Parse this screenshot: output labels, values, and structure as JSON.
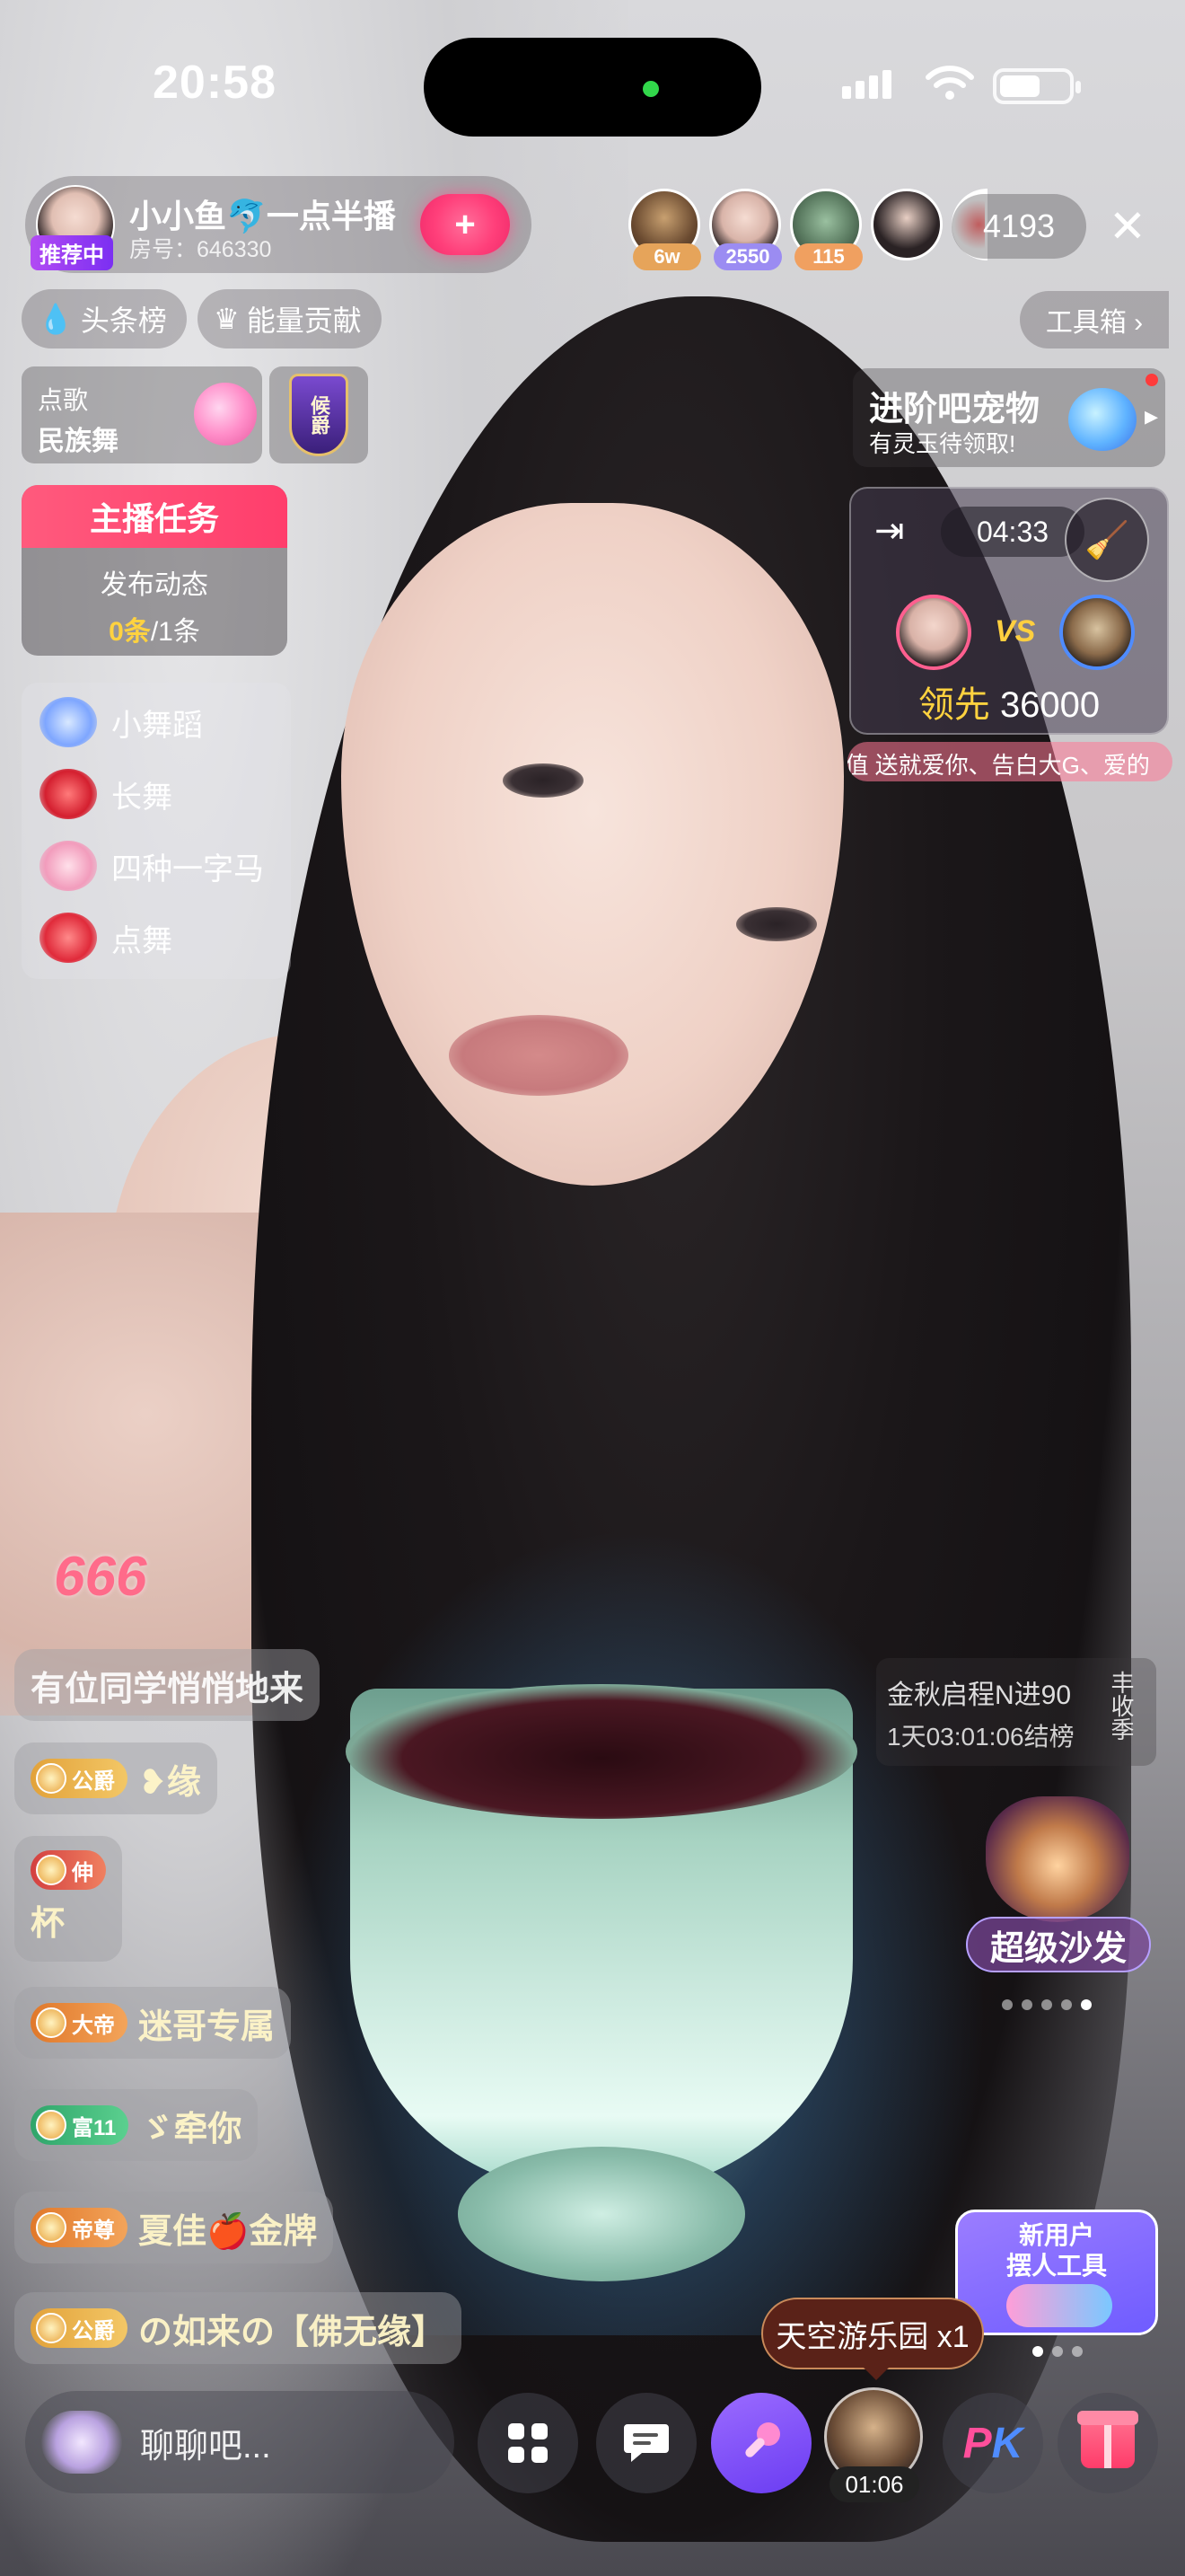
{
  "status_bar": {
    "time": "20:58"
  },
  "host": {
    "name": "小小鱼🐬一点半播",
    "badge": "推荐中",
    "room": "房号：646330",
    "follow_label": "+"
  },
  "viewers": {
    "tags": [
      "6w",
      "2550",
      "115"
    ],
    "count": "4193",
    "close_label": "✕"
  },
  "chips": {
    "headline": "头条榜",
    "energy": "能量贡献",
    "toolbox": "工具箱 ›"
  },
  "song": {
    "label": "点歌",
    "title": "民族舞"
  },
  "rank_badge": "候爵",
  "task": {
    "header": "主播任务",
    "item": "发布动态",
    "progress_done": "0条",
    "progress_total": "/1条"
  },
  "dance_list": {
    "items": [
      "小舞蹈",
      "长舞",
      "四种一字马",
      "点舞"
    ]
  },
  "pet_banner": {
    "title": "进阶吧宠物",
    "subtitle": "有灵玉待领取!"
  },
  "pk": {
    "timer": "04:33",
    "vs": "VS",
    "lead_label": "领先",
    "lead_value": "36000",
    "marquee": "ok值  送就爱你、告白大G、爱的"
  },
  "event": {
    "title": "金秋启程N进90",
    "countdown": "1天03:01:06结榜",
    "side": "丰收季"
  },
  "sofa": {
    "label": "超级沙发"
  },
  "new_user": {
    "line1": "新用户",
    "line2": "摆人工具"
  },
  "chat": {
    "gift_number": "666",
    "system_msg": "有位同学悄悄地来",
    "rows": [
      {
        "level": "公爵",
        "name": "❥缘"
      },
      {
        "level": "伸",
        "name": "杯"
      },
      {
        "level": "大帝",
        "name": "迷哥专属"
      },
      {
        "level": "富11",
        "name": "ゞ牵你"
      },
      {
        "level": "帝尊",
        "name": "夏佳🍎金牌"
      },
      {
        "level": "公爵",
        "name": "の如来の【佛无缘】"
      }
    ]
  },
  "bottom": {
    "input_placeholder": "聊聊吧...",
    "game_tooltip": "天空游乐园 x1",
    "game_timer": "01:06",
    "pk_p": "P",
    "pk_k": "K"
  },
  "colors": {
    "accent_pink": "#ff3e6c",
    "gold": "#ffd23f"
  }
}
